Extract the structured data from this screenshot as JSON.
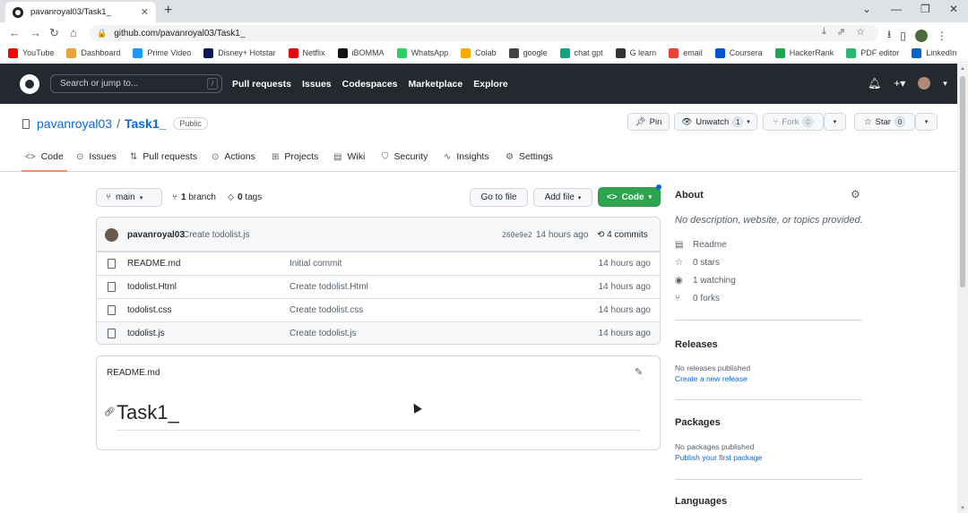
{
  "browser": {
    "tab_title": "pavanroyal03/Task1_",
    "tab_close": "✕",
    "new_tab": "+",
    "url": "github.com/pavanroyal03/Task1_",
    "bookmarks": [
      {
        "label": "YouTube",
        "color": "#ff0000"
      },
      {
        "label": "Dashboard",
        "color": "#e8a33d"
      },
      {
        "label": "Prime Video",
        "color": "#1a98ff"
      },
      {
        "label": "Disney+ Hotstar",
        "color": "#0c1a5c"
      },
      {
        "label": "Netflix",
        "color": "#e50914"
      },
      {
        "label": "iBOMMA",
        "color": "#111111"
      },
      {
        "label": "WhatsApp",
        "color": "#25d366"
      },
      {
        "label": "Colab",
        "color": "#f9ab00"
      },
      {
        "label": "google",
        "color": "#444444"
      },
      {
        "label": "chat gpt",
        "color": "#10a37f"
      },
      {
        "label": "G learn",
        "color": "#333333"
      },
      {
        "label": "email",
        "color": "#ea4335"
      },
      {
        "label": "Coursera",
        "color": "#0056d2"
      },
      {
        "label": "HackerRank",
        "color": "#1ba94c"
      },
      {
        "label": "PDF editor",
        "color": "#2bb673"
      },
      {
        "label": "LinkedIn",
        "color": "#0a66c2"
      }
    ]
  },
  "header": {
    "search_placeholder": "Search or jump to...",
    "search_key": "/",
    "nav": [
      "Pull requests",
      "Issues",
      "Codespaces",
      "Marketplace",
      "Explore"
    ]
  },
  "repo": {
    "owner": "pavanroyal03",
    "separator": "/",
    "name": "Task1_",
    "visibility": "Public",
    "pin_label": "Pin",
    "unwatch_label": "Unwatch",
    "unwatch_count": "1",
    "fork_label": "Fork",
    "fork_count": "0",
    "star_label": "Star",
    "star_count": "0"
  },
  "tabs": [
    "Code",
    "Issues",
    "Pull requests",
    "Actions",
    "Projects",
    "Wiki",
    "Security",
    "Insights",
    "Settings"
  ],
  "filebar": {
    "branch": "main",
    "branches_count": "1",
    "branches_label": "branch",
    "tags_count": "0",
    "tags_label": "tags",
    "go_to_file": "Go to file",
    "add_file": "Add file",
    "code": "Code"
  },
  "commit": {
    "author": "pavanroyal03",
    "message": "Create todolist.js",
    "hash": "260e9e2",
    "time": "14 hours ago",
    "commits_count": "4",
    "commits_label": "commits"
  },
  "files": [
    {
      "name": "README.md",
      "message": "Initial commit",
      "time": "14 hours ago"
    },
    {
      "name": "todolist.Html",
      "message": "Create todolist.Html",
      "time": "14 hours ago"
    },
    {
      "name": "todolist.css",
      "message": "Create todolist.css",
      "time": "14 hours ago"
    },
    {
      "name": "todolist.js",
      "message": "Create todolist.js",
      "time": "14 hours ago"
    }
  ],
  "readme": {
    "file_label": "README.md",
    "heading": "Task1_"
  },
  "sidebar": {
    "about_title": "About",
    "about_desc": "No description, website, or topics provided.",
    "readme": "Readme",
    "stars": "0 stars",
    "watching": "1 watching",
    "forks": "0 forks",
    "releases_title": "Releases",
    "releases_none": "No releases published",
    "releases_link": "Create a new release",
    "packages_title": "Packages",
    "packages_none": "No packages published",
    "packages_link": "Publish your first package",
    "languages_title": "Languages"
  }
}
